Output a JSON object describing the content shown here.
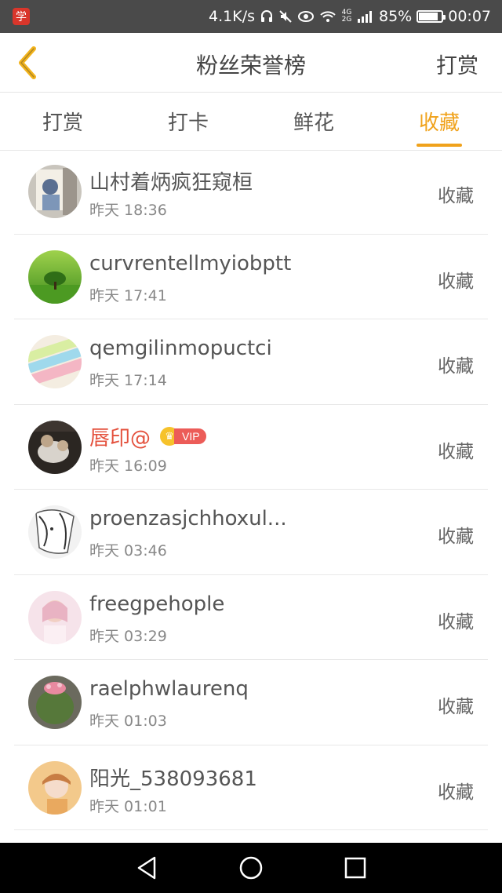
{
  "status_bar": {
    "app_badge": "学",
    "net_speed": "4.1K/s",
    "network": "4G 2G",
    "battery_level": 0.85,
    "battery": "85%",
    "time": "00:07"
  },
  "header": {
    "title": "粉丝荣誉榜",
    "action": "打赏"
  },
  "tabs": [
    {
      "label": "打赏",
      "active": false
    },
    {
      "label": "打卡",
      "active": false
    },
    {
      "label": "鲜花",
      "active": false
    },
    {
      "label": "收藏",
      "active": true
    }
  ],
  "list": [
    {
      "name": "山村着炳疯狂窥桓",
      "time": "昨天 18:36",
      "action": "收藏",
      "vip": false
    },
    {
      "name": "curvrentellmyiobptt",
      "time": "昨天 17:41",
      "action": "收藏",
      "vip": false
    },
    {
      "name": "qemgilinmopuctci",
      "time": "昨天 17:14",
      "action": "收藏",
      "vip": false
    },
    {
      "name": "唇印@",
      "time": "昨天 16:09",
      "action": "收藏",
      "vip": true,
      "vip_label": "VIP"
    },
    {
      "name": "proenzasjchhoxul...",
      "time": "昨天 03:46",
      "action": "收藏",
      "vip": false
    },
    {
      "name": "freegpehople",
      "time": "昨天 03:29",
      "action": "收藏",
      "vip": false
    },
    {
      "name": "raelphwlaurenq",
      "time": "昨天 01:03",
      "action": "收藏",
      "vip": false
    },
    {
      "name": "阳光_538093681",
      "time": "昨天 01:01",
      "action": "收藏",
      "vip": false
    }
  ],
  "colors": {
    "accent": "#f0a21b",
    "vip_name": "#e4513d",
    "vip_tag": "#ec5c58"
  },
  "icons": {
    "back": "chevron-left-icon",
    "nav_back": "triangle-back-icon",
    "nav_home": "circle-home-icon",
    "nav_recent": "square-recent-icon"
  }
}
